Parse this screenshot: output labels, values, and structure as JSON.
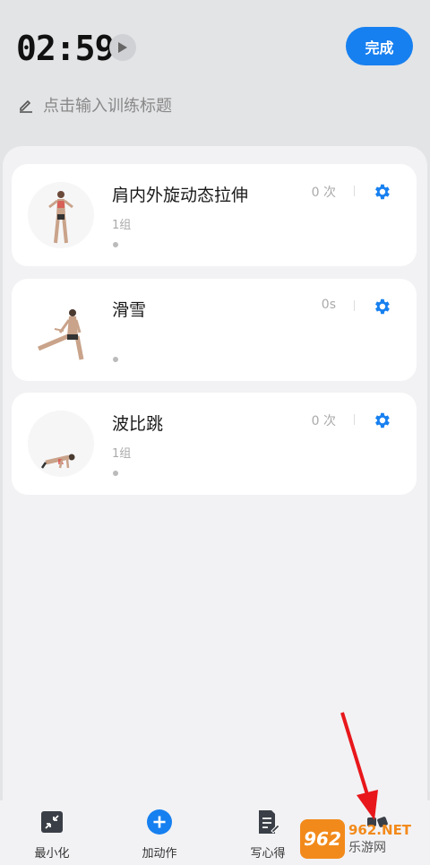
{
  "header": {
    "timer": "02:59",
    "done_label": "完成",
    "title_placeholder": "点击输入训练标题"
  },
  "exercises": [
    {
      "name": "肩内外旋动态拉伸",
      "count": "0 次",
      "sets": "1组"
    },
    {
      "name": "滑雪",
      "count": "0s",
      "sets": ""
    },
    {
      "name": "波比跳",
      "count": "0 次",
      "sets": "1组"
    }
  ],
  "bottom_tabs": [
    {
      "label": "最小化",
      "icon": "minimize-icon"
    },
    {
      "label": "加动作",
      "icon": "plus-circle-icon"
    },
    {
      "label": "写心得",
      "icon": "note-edit-icon"
    }
  ],
  "watermark": {
    "logo": "962",
    "text_top": "962.NET",
    "text_bottom": "乐游网"
  },
  "colors": {
    "accent": "#1780f0",
    "arrow": "#e8171b",
    "watermark": "#f28a1b"
  }
}
